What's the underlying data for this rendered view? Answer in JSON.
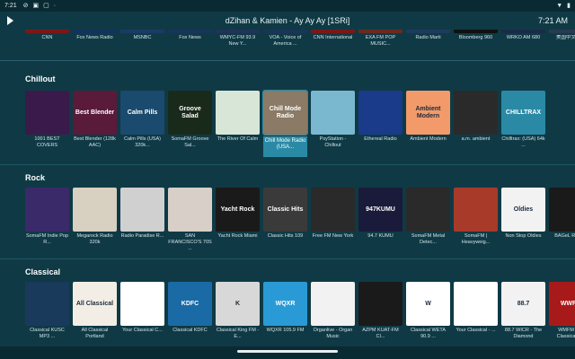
{
  "statusbar": {
    "time": "7:21",
    "icons": [
      "notification-icon",
      "sync-icon",
      "media-icon",
      "download-icon"
    ],
    "right_icons": [
      "wifi-icon",
      "battery-icon"
    ]
  },
  "topbar": {
    "now_playing": "dZihan & Kamien - Ay Ay Ay [1SRi]",
    "clock": "7:21 AM"
  },
  "top_row": {
    "items": [
      {
        "label": "CNN",
        "color": "#7a1818"
      },
      {
        "label": "Fox News Radio",
        "color": "#13325c"
      },
      {
        "label": "MSNBC",
        "color": "#1b3a66"
      },
      {
        "label": "Fox News",
        "color": "#18345c"
      },
      {
        "label": "WMYC-FM 93.9 New Y...",
        "color": "#20335a"
      },
      {
        "label": "VOA - Voice of America ...",
        "color": "#1a3558"
      },
      {
        "label": "CNN International",
        "color": "#7a1818"
      },
      {
        "label": "EXA FM POP MUSIC...",
        "color": "#6a2a20"
      },
      {
        "label": "Radio Marti",
        "color": "#1e3a5c"
      },
      {
        "label": "Bloomberg 960",
        "color": "#111111"
      },
      {
        "label": "WRKO AM 680",
        "color": "#1a2b48"
      },
      {
        "label": "美国中文电台",
        "color": "#2a3a50"
      }
    ]
  },
  "chillout": {
    "title": "Chillout",
    "items": [
      {
        "label": "1001 BEST COVERS",
        "art": "",
        "color": "#3a1a4a"
      },
      {
        "label": "Best Blender (128k AAC)",
        "art": "Best Blender",
        "color": "#5a1a3a"
      },
      {
        "label": "Calm Pills (USA) 320k...",
        "art": "Calm Pills",
        "color": "#1a4a6e"
      },
      {
        "label": "SomaFM Groove Sal...",
        "art": "Groove Salad",
        "color": "#1a2a1a"
      },
      {
        "label": "The River Of Calm",
        "art": "",
        "color": "#d8e6d8"
      },
      {
        "label": "Chill Mode Radio (USA...",
        "art": "Chill Mode Radio",
        "color": "#8a7a66"
      },
      {
        "label": "PsyStation - Chillout",
        "art": "",
        "color": "#7ab8d0"
      },
      {
        "label": "Ethereal Radio",
        "art": "",
        "color": "#1a3a8a"
      },
      {
        "label": "Ambient Modern",
        "art": "Ambient Modern",
        "color": "#f29a6a"
      },
      {
        "label": "a.m. ambient",
        "art": "",
        "color": "#2a2a2a"
      },
      {
        "label": "Chilltrax: (USA) 64k ...",
        "art": "CHILLTRAX",
        "color": "#2a8aa6"
      }
    ]
  },
  "rock": {
    "title": "Rock",
    "items": [
      {
        "label": "SomaFM Indie Pop R...",
        "art": "",
        "color": "#3a2a6a"
      },
      {
        "label": "Megarock Radio 320k",
        "art": "",
        "color": "#d8d0c0"
      },
      {
        "label": "Radio Paradise R...",
        "art": "",
        "color": "#d0d0d0"
      },
      {
        "label": "SAN FRANCISCO'S 70S ...",
        "art": "",
        "color": "#d8d0c8"
      },
      {
        "label": "Yacht Rock Miami",
        "art": "Yacht Rock",
        "color": "#1a1a1a"
      },
      {
        "label": "Classic Hits 109",
        "art": "Classic Hits",
        "color": "#3a3a3a"
      },
      {
        "label": "Free FM New York",
        "art": "",
        "color": "#2a2a2a"
      },
      {
        "label": "94.7 KUMU",
        "art": "947KUMU",
        "color": "#1a1a3a"
      },
      {
        "label": "SomaFM Metal Detec...",
        "art": "",
        "color": "#2a2a2a"
      },
      {
        "label": "SomaFM | Heavyweig...",
        "art": "",
        "color": "#a83a2a"
      },
      {
        "label": "Non Stop Oldies",
        "art": "Oldies",
        "color": "#f2f2f2"
      },
      {
        "label": "BAGeL RADIO",
        "art": "",
        "color": "#1a1a1a"
      }
    ]
  },
  "classical": {
    "title": "Classical",
    "items": [
      {
        "label": "Classical KUSC MP3 ...",
        "art": "",
        "color": "#1a3a5c"
      },
      {
        "label": "All Classical Portland",
        "art": "All Classical",
        "color": "#f2eee6"
      },
      {
        "label": "Your Classical C...",
        "art": "",
        "color": "#ffffff"
      },
      {
        "label": "Classical KDFC",
        "art": "KDFC",
        "color": "#1a6aa6"
      },
      {
        "label": "Classical King FM - E...",
        "art": "K",
        "color": "#d8d8d8"
      },
      {
        "label": "WQXR 105.9 FM",
        "art": "WQXR",
        "color": "#2a9ad6"
      },
      {
        "label": "Organlive - Organ Music",
        "art": "",
        "color": "#f2f2f2"
      },
      {
        "label": "AZPM KUAT-FM Cl...",
        "art": "",
        "color": "#1a1a1a"
      },
      {
        "label": "Classical WETA 90.9 ...",
        "art": "W",
        "color": "#ffffff"
      },
      {
        "label": "Your Classical - ...",
        "art": "",
        "color": "#ffffff"
      },
      {
        "label": "88.7 WICR - The Diamond",
        "art": "88.7",
        "color": "#f2f2f2"
      },
      {
        "label": "WMFM The Classical S...",
        "art": "WWFM",
        "color": "#a81a1a"
      }
    ]
  },
  "selected_item": "Chill Mode Radio (USA..."
}
